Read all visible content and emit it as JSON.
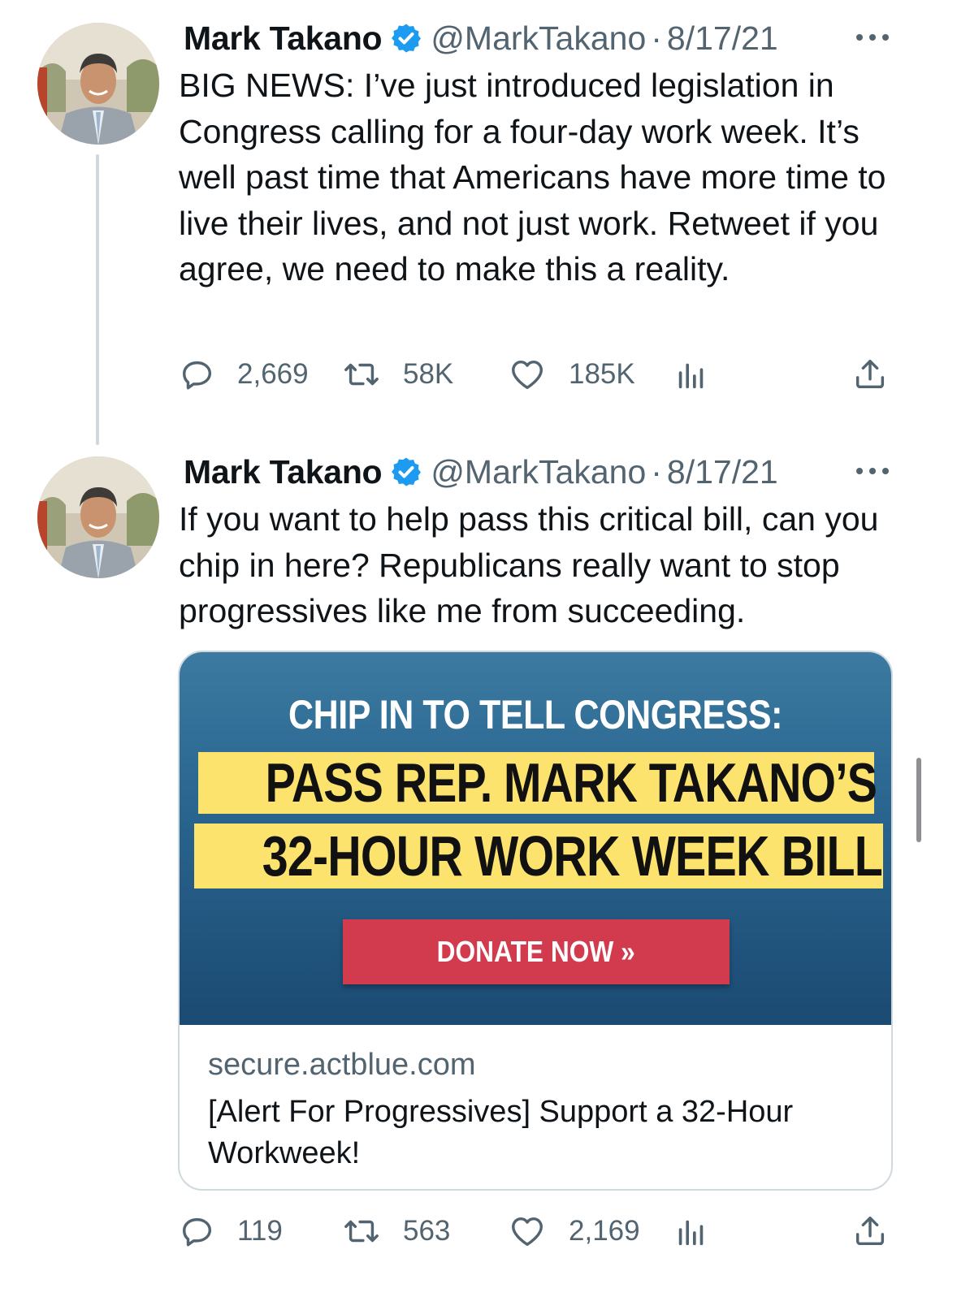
{
  "colors": {
    "verified": "#1d9bf0",
    "secondary_text": "#536471",
    "banner_yellow": "#fbe36e",
    "donate_red": "#d23a4e",
    "banner_blue": "#2a6690"
  },
  "tweets": [
    {
      "author_name": "Mark Takano",
      "handle": "@MarkTakano",
      "separator": "·",
      "date": "8/17/21",
      "text": "BIG NEWS: I’ve just introduced legislation in Congress calling for a four-day work week. It’s well past time that Americans have more time to live their lives, and not just work. Retweet if you agree, we need to make this a reality.",
      "replies": "2,669",
      "retweets": "58K",
      "likes": "185K",
      "icons": [
        "reply-icon",
        "retweet-icon",
        "like-icon",
        "analytics-icon",
        "share-icon"
      ]
    },
    {
      "author_name": "Mark Takano",
      "handle": "@MarkTakano",
      "separator": "·",
      "date": "8/17/21",
      "text": "If you want to help pass this critical bill, can you chip in here? Republicans really want to stop progressives like me from succeeding.",
      "replies": "119",
      "retweets": "563",
      "likes": "2,169",
      "card": {
        "banner_line1": "CHIP IN TO TELL CONGRESS:",
        "banner_line2": "PASS REP. MARK TAKANO’S",
        "banner_line3": "32-HOUR WORK WEEK BILL",
        "button_label": "DONATE NOW »",
        "domain": "secure.actblue.com",
        "title": "[Alert For Progressives] Support a 32-Hour Workweek!"
      }
    }
  ]
}
